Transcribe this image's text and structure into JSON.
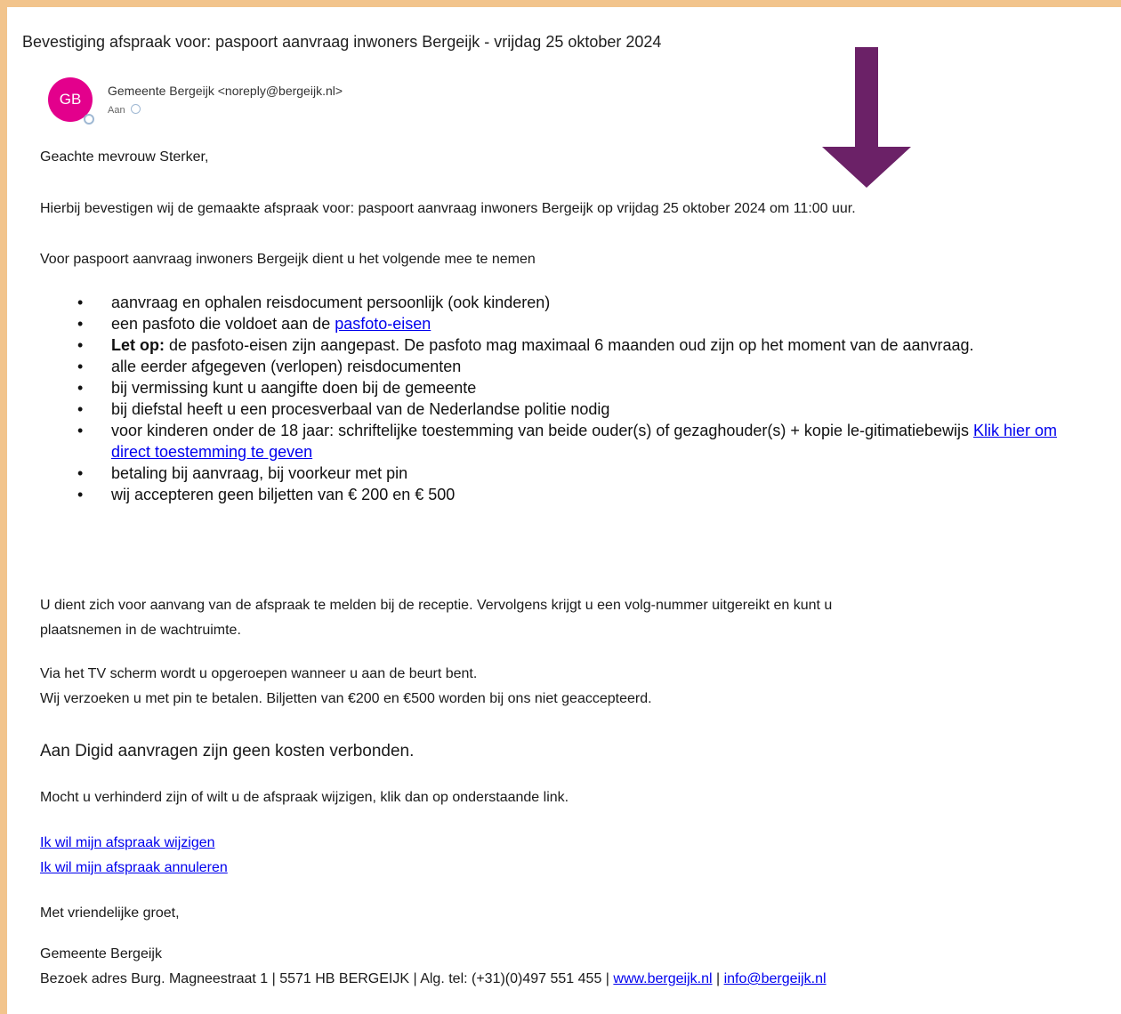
{
  "email": {
    "subject": "Bevestiging afspraak voor: paspoort aanvraag inwoners Bergeijk - vrijdag 25 oktober 2024",
    "sender": {
      "initials": "GB",
      "display": "Gemeente Bergeijk <noreply@bergeijk.nl>",
      "avatar_color": "#e3008c"
    },
    "to_label": "Aan",
    "greeting": "Geachte mevrouw Sterker,",
    "confirmation": "Hierbij bevestigen wij de gemaakte afspraak voor: paspoort aanvraag inwoners Bergeijk op vrijdag 25 oktober 2024 om 11:00 uur.",
    "bring_intro": "Voor paspoort aanvraag inwoners Bergeijk dient u het volgende mee te nemen",
    "bullets": {
      "b1": "aanvraag en ophalen reisdocument persoonlijk  (ook kinderen)",
      "b2_text": "een pasfoto die voldoet aan de ",
      "b2_link": "pasfoto-eisen",
      "b3_bold": "Let op:",
      "b3_text": " de pasfoto-eisen zijn aangepast. De pasfoto mag maximaal 6 maanden oud zijn op het moment van de aanvraag.",
      "b4": "alle eerder afgegeven (verlopen) reisdocumenten",
      "b5": "bij vermissing kunt u aangifte doen bij de gemeente",
      "b6": "bij diefstal heeft u een procesverbaal van de Nederlandse politie nodig",
      "b7_text": "voor kinderen onder de 18 jaar: schriftelijke toestemming van beide ouder(s) of gezaghouder(s) + kopie le-gitimatiebewijs ",
      "b7_link": "Klik hier om direct toestemming te geven",
      "b8": "betaling bij aanvraag, bij voorkeur met pin",
      "b9": "wij accepteren geen biljetten van € 200 en € 500"
    },
    "reception_l1": "U dient zich voor aanvang van de afspraak te melden bij de receptie. Vervolgens krijgt u een volg-nummer uitgereikt en kunt u",
    "reception_l2": "plaatsnemen in de wachtruimte.",
    "tv_line": "Via het TV scherm wordt u opgeroepen wanneer u aan de beurt bent.",
    "pin_line": "Wij verzoeken u met pin te betalen. Biljetten van €200 en €500 worden bij ons niet geaccepteerd.",
    "digid": "Aan Digid aanvragen zijn geen kosten verbonden.",
    "change_intro": "Mocht u verhinderd zijn of wilt u de afspraak wijzigen, klik dan op onderstaande link.",
    "link_change": "Ik wil mijn afspraak wijzigen",
    "link_cancel": "Ik wil mijn afspraak annuleren",
    "closing": "Met vriendelijke groet,",
    "signature_org": "Gemeente Bergeijk",
    "footer_text": "Bezoek adres Burg. Magneestraat 1 | 5571 HB BERGEIJK | Alg. tel: (+31)(0)497 551 455 | ",
    "footer_site": "www.bergeijk.nl",
    "footer_sep": " | ",
    "footer_mail": "info@bergeijk.nl"
  },
  "annotation": {
    "arrow_color": "#6b2167",
    "arrow_direction": "down"
  }
}
